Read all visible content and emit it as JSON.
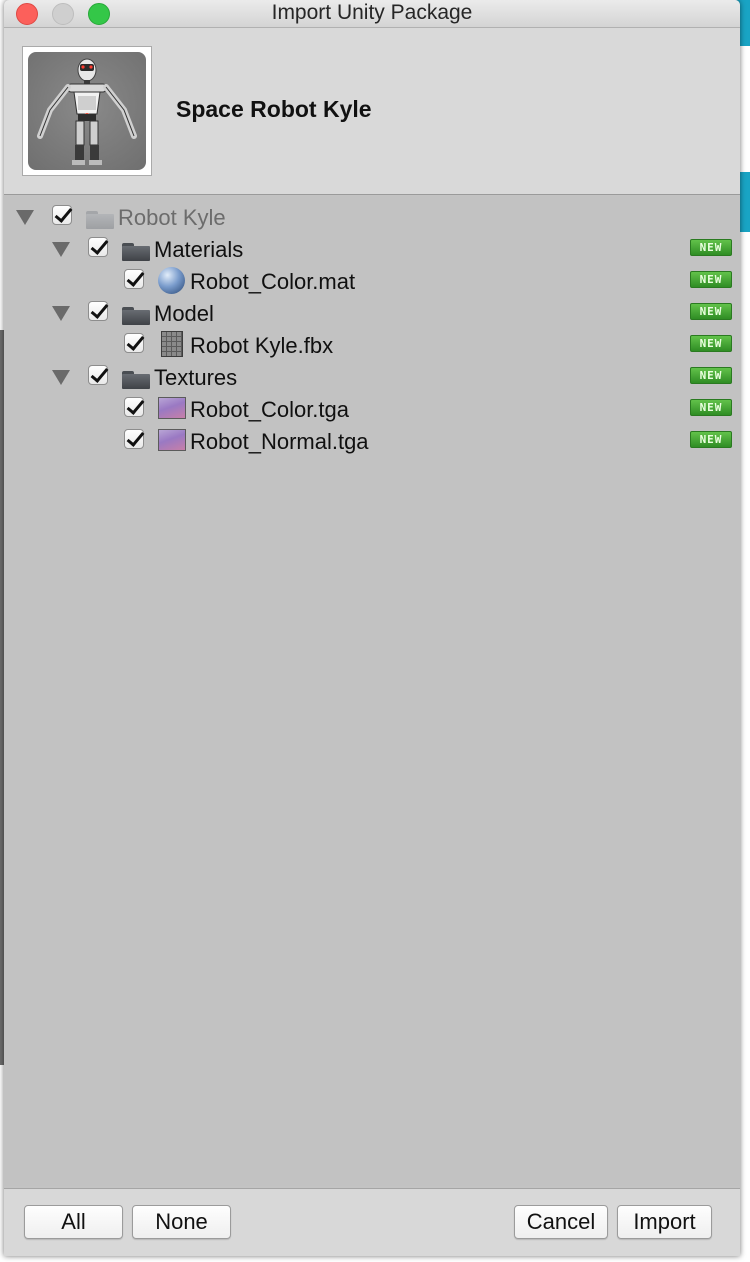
{
  "window": {
    "title": "Import Unity Package"
  },
  "package": {
    "name": "Space Robot Kyle"
  },
  "tree": {
    "new_badge": "NEW",
    "items": [
      {
        "label": "Robot Kyle",
        "type": "folder",
        "checked": true,
        "expanded": true,
        "is_new": false
      },
      {
        "label": "Materials",
        "type": "folder",
        "checked": true,
        "expanded": true,
        "is_new": true
      },
      {
        "label": "Robot_Color.mat",
        "type": "material",
        "checked": true,
        "is_new": true
      },
      {
        "label": "Model",
        "type": "folder",
        "checked": true,
        "expanded": true,
        "is_new": true
      },
      {
        "label": "Robot Kyle.fbx",
        "type": "mesh",
        "checked": true,
        "is_new": true
      },
      {
        "label": "Textures",
        "type": "folder",
        "checked": true,
        "expanded": true,
        "is_new": true
      },
      {
        "label": "Robot_Color.tga",
        "type": "texture",
        "checked": true,
        "is_new": true
      },
      {
        "label": "Robot_Normal.tga",
        "type": "texture",
        "checked": true,
        "is_new": true
      }
    ]
  },
  "footer": {
    "all_label": "All",
    "none_label": "None",
    "cancel_label": "Cancel",
    "import_label": "Import"
  },
  "colors": {
    "accent_cyan": "#19a4c4",
    "new_badge_green": "#3f9f31"
  }
}
